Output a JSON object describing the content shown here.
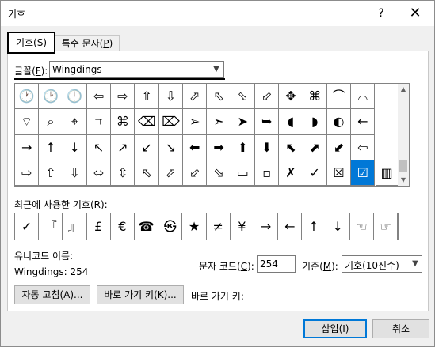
{
  "window": {
    "title": "기호",
    "help_label": "?",
    "close_label": "✕"
  },
  "tabs": [
    {
      "label": "기호(",
      "accel": "S",
      "tail": ")"
    },
    {
      "label": "특수 문자(",
      "accel": "P",
      "tail": ")"
    }
  ],
  "font": {
    "label": "글꼴(",
    "accel": "F",
    "tail": "):",
    "value": "Wingdings"
  },
  "symbol_grid": [
    [
      "🕐",
      "🕑",
      "🕒",
      "⇦",
      "⇨",
      "⇧",
      "⇩",
      "⬀",
      "⬁",
      "⬂",
      "⬃",
      "✥",
      "⌘",
      "⌒",
      "⌓"
    ],
    [
      "⌔",
      "⌕",
      "⌖",
      "⌗",
      "⌘",
      "⌫",
      "⌦",
      "➢",
      "➣",
      "➤",
      "➥",
      "◖",
      "◗",
      "◐",
      "←"
    ],
    [
      "→",
      "↑",
      "↓",
      "↖",
      "↗",
      "↙",
      "↘",
      "⬅",
      "➡",
      "⬆",
      "⬇",
      "⬉",
      "⬈",
      "⬋",
      "⇦"
    ],
    [
      "⇨",
      "⇧",
      "⇩",
      "⬄",
      "⇳",
      "⬁",
      "⬀",
      "⬃",
      "⬂",
      "▭",
      "▫",
      "✗",
      "✓",
      "☒",
      "☑",
      "▥"
    ]
  ],
  "selected_symbol": "☑",
  "recent": {
    "label": "최근에 사용한 기호(",
    "accel": "R",
    "tail": "):",
    "items": [
      "✓",
      "『",
      "』",
      "£",
      "€",
      "☎",
      "㉿",
      "★",
      "≠",
      "¥",
      "→",
      "←",
      "↑",
      "↓",
      "☜",
      "☞"
    ]
  },
  "unicode_name": {
    "label": "유니코드 이름:",
    "value": "Wingdings: 254"
  },
  "char_code": {
    "label": "문자 코드(",
    "accel": "C",
    "tail": "):",
    "value": "254"
  },
  "from": {
    "label": "기준(",
    "accel": "M",
    "tail": "):",
    "value": "기호(10진수)"
  },
  "buttons": {
    "autocorrect": "자동 고침(A)...",
    "shortcut_key": "바로 가기 키(K)...",
    "shortcut_label": "바로 가기 키:",
    "insert": "삽입(I)",
    "cancel": "취소"
  }
}
